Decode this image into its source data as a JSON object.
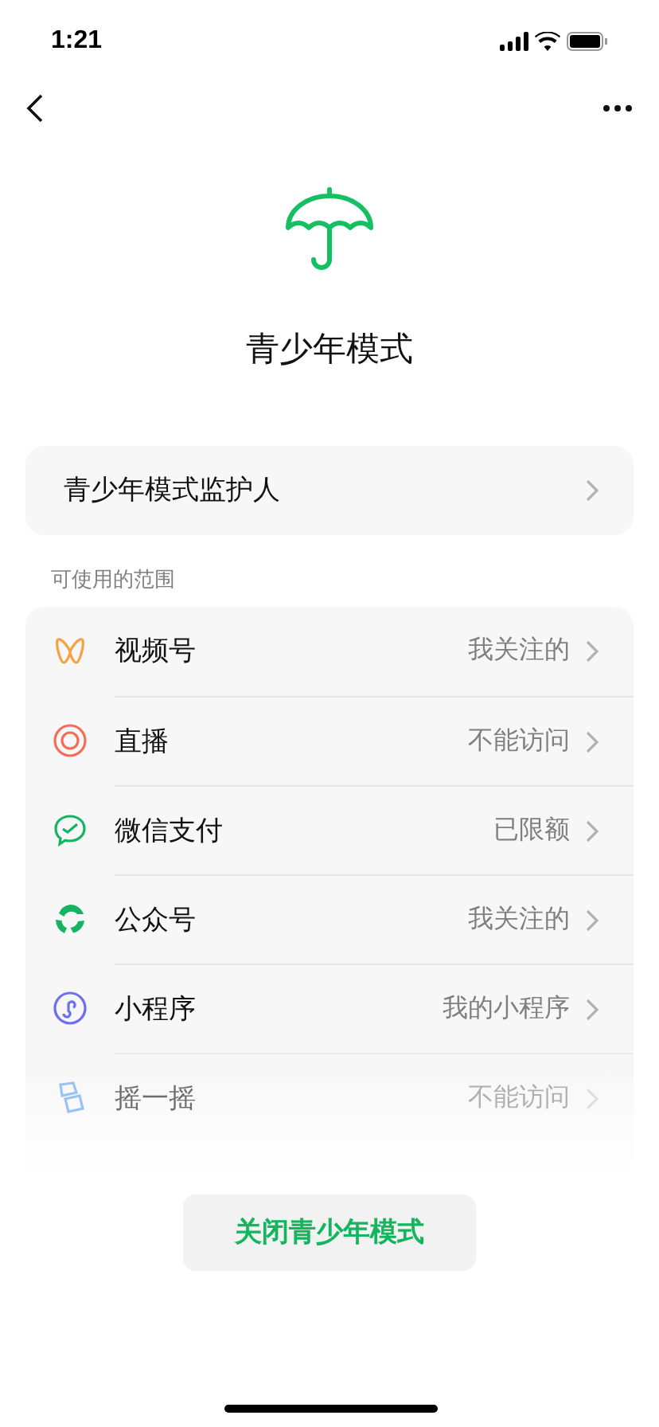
{
  "status_bar": {
    "time": "1:21"
  },
  "title": "青少年模式",
  "guardian": {
    "label": "青少年模式监护人"
  },
  "section_label": "可使用的范围",
  "items": [
    {
      "kind": "channels",
      "label": "视频号",
      "value": "我关注的",
      "faded": false
    },
    {
      "kind": "live",
      "label": "直播",
      "value": "不能访问",
      "faded": false
    },
    {
      "kind": "pay",
      "label": "微信支付",
      "value": "已限额",
      "faded": false
    },
    {
      "kind": "official",
      "label": "公众号",
      "value": "我关注的",
      "faded": false
    },
    {
      "kind": "miniprogram",
      "label": "小程序",
      "value": "我的小程序",
      "faded": false
    },
    {
      "kind": "shake",
      "label": "摇一摇",
      "value": "不能访问",
      "faded": true
    }
  ],
  "close_button": "关闭青少年模式"
}
